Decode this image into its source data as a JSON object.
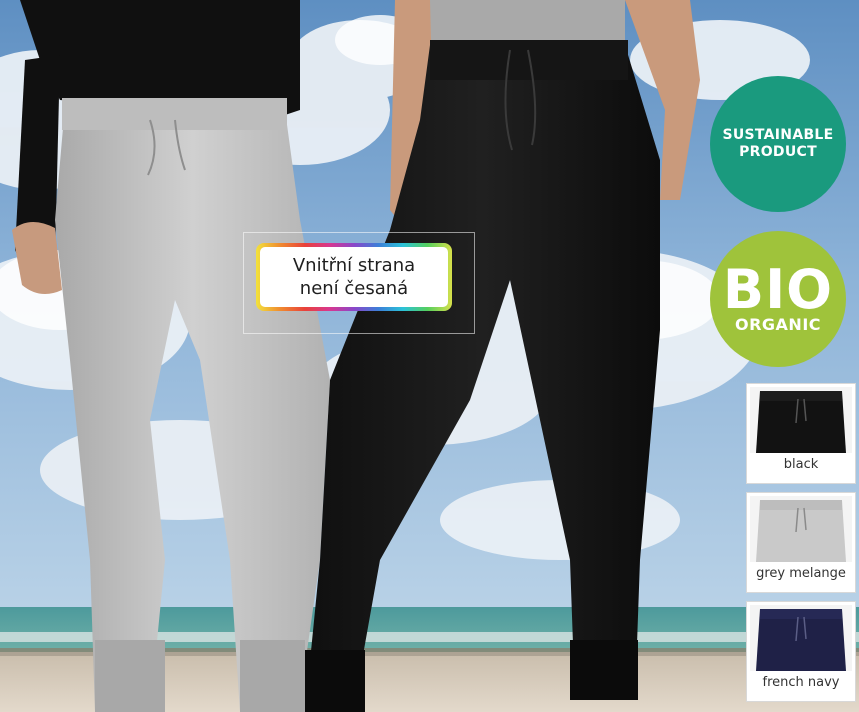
{
  "feature_label": {
    "line1": "Vnitřní strana",
    "line2": "není česaná"
  },
  "badges": {
    "sustainable": {
      "line1": "SUSTAINABLE",
      "line2": "PRODUCT",
      "color": "#1a9a7e"
    },
    "bio": {
      "main": "BIO",
      "sub": "ORGANIC",
      "color": "#9fc33b"
    }
  },
  "color_swatches": [
    {
      "label": "black",
      "color": "#121212"
    },
    {
      "label": "grey melange",
      "color": "#c9c9c9"
    },
    {
      "label": "french navy",
      "color": "#1f2147"
    }
  ]
}
